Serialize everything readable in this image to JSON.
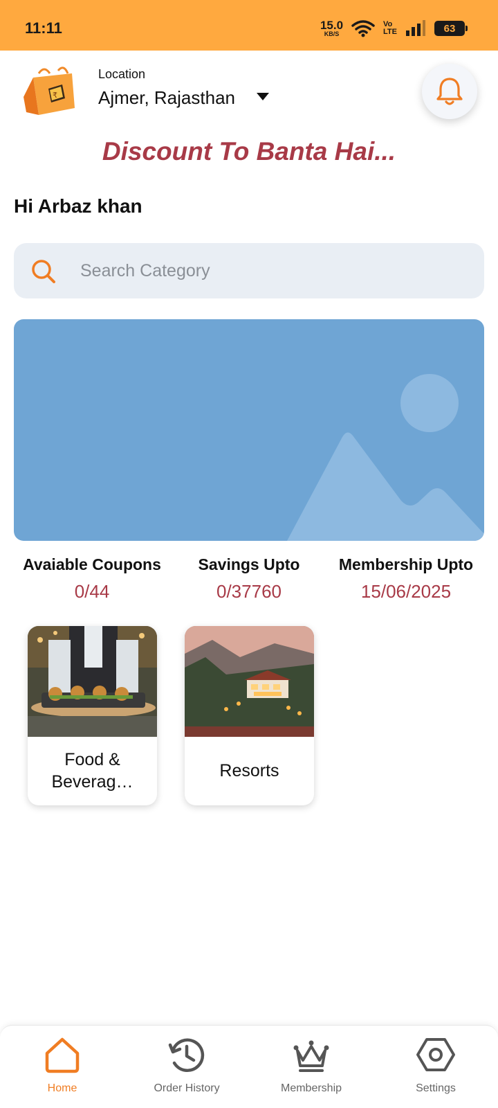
{
  "status_bar": {
    "time": "11:11",
    "net_speed": "15.0",
    "net_unit": "KB/S",
    "volte_top": "Vo",
    "volte_bottom": "LTE",
    "battery": "63"
  },
  "header": {
    "location_label": "Location",
    "location_value": "Ajmer, Rajasthan"
  },
  "tagline": "Discount To Banta Hai...",
  "greeting": "Hi Arbaz khan",
  "search": {
    "placeholder": "Search Category"
  },
  "stats": [
    {
      "label": "Avaiable Coupons",
      "value": "0/44"
    },
    {
      "label": "Savings Upto",
      "value": "0/37760"
    },
    {
      "label": "Membership Upto",
      "value": "15/06/2025"
    }
  ],
  "categories": [
    {
      "label": "Food & Beverag…"
    },
    {
      "label": "Resorts"
    }
  ],
  "bottom_nav": [
    {
      "label": "Home",
      "icon": "home-icon",
      "active": true
    },
    {
      "label": "Order History",
      "icon": "history-icon",
      "active": false
    },
    {
      "label": "Membership",
      "icon": "crown-icon",
      "active": false
    },
    {
      "label": "Settings",
      "icon": "settings-icon",
      "active": false
    }
  ],
  "colors": {
    "status_bar": "#ffa93f",
    "accent": "#f07d23",
    "brand_text": "#a83a47",
    "banner": "#6fa5d4",
    "search_bg": "#e9eef4"
  }
}
